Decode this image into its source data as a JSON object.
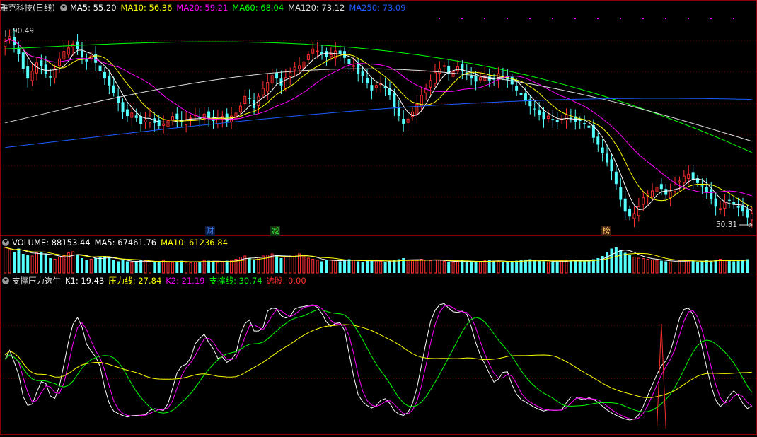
{
  "main_panel": {
    "stock_name": "雅克科技",
    "period": "(日线)",
    "indicators": [
      {
        "label": "MA5: 55.20",
        "color": "#ffffff"
      },
      {
        "label": "MA10: 56.36",
        "color": "#ffff00"
      },
      {
        "label": "MA20: 59.21",
        "color": "#ff00ff"
      },
      {
        "label": "MA60: 68.04",
        "color": "#00ff00"
      },
      {
        "label": "MA120: 73.12",
        "color": "#dddddd"
      },
      {
        "label": "MA250: 73.09",
        "color": "#1e5cff"
      }
    ],
    "high_label": "90.49",
    "low_label": "50.31",
    "markers": [
      {
        "text": "财",
        "color": "#3a8bff",
        "bg": "#101a40"
      },
      {
        "text": "减",
        "color": "#40ff40",
        "bg": "#103010"
      },
      {
        "text": "榜",
        "color": "#ffcc66",
        "bg": "#402010"
      }
    ]
  },
  "volume_panel": {
    "indicators": [
      {
        "label": "VOLUME: 88153.44",
        "color": "#ffffff"
      },
      {
        "label": "MA5: 67461.76",
        "color": "#ffffff"
      },
      {
        "label": "MA10: 61236.84",
        "color": "#ffff00"
      }
    ]
  },
  "osc_panel": {
    "title": "支撑压力选牛",
    "indicators": [
      {
        "label": "K1: 19.43",
        "color": "#ffffff"
      },
      {
        "label": "压力线: 27.84",
        "color": "#ffff00"
      },
      {
        "label": "K2: 21.19",
        "color": "#ff00ff"
      },
      {
        "label": "支撑线: 30.74",
        "color": "#00ff00"
      },
      {
        "label": "选股: 0.00",
        "color": "#ff3030"
      }
    ]
  },
  "colors": {
    "up": "#ff3030",
    "down": "#54ffff",
    "grid": "#8b0000",
    "ma5": "#ffffff",
    "ma10": "#ffff00",
    "ma20": "#ff00ff",
    "ma60": "#00ff00",
    "ma120": "#dddddd",
    "ma250": "#1e5cff"
  },
  "chart_data": {
    "type": "candlestick",
    "ylim": [
      50.31,
      90.49
    ],
    "close": [
      87.5,
      88.5,
      86.8,
      85.0,
      82.0,
      80.0,
      81.5,
      83.2,
      82.6,
      81.0,
      80.2,
      82.0,
      84.0,
      85.5,
      86.2,
      87.0,
      86.0,
      84.3,
      83.5,
      84.6,
      83.2,
      81.5,
      80.0,
      78.6,
      77.0,
      75.1,
      73.2,
      72.4,
      73.0,
      72.0,
      70.8,
      71.6,
      72.2,
      71.0,
      70.4,
      70.8,
      71.5,
      72.3,
      71.8,
      71.2,
      71.6,
      72.0,
      72.6,
      72.0,
      72.8,
      71.8,
      71.4,
      71.9,
      72.3,
      71.3,
      72.4,
      73.0,
      74.4,
      76.4,
      76.0,
      74.0,
      76.4,
      78.0,
      79.2,
      80.6,
      80.0,
      78.6,
      80.2,
      81.2,
      82.3,
      82.6,
      83.4,
      84.8,
      86.0,
      85.6,
      85.0,
      84.4,
      84.8,
      85.6,
      85.0,
      84.2,
      83.0,
      82.6,
      81.0,
      80.6,
      79.0,
      77.6,
      78.6,
      79.0,
      78.0,
      76.6,
      74.2,
      72.4,
      70.8,
      71.8,
      73.2,
      74.8,
      76.6,
      78.0,
      79.6,
      81.2,
      82.0,
      82.6,
      81.0,
      81.4,
      82.4,
      81.6,
      81.0,
      80.0,
      79.4,
      80.2,
      80.6,
      79.6,
      79.8,
      81.0,
      80.4,
      79.8,
      78.8,
      77.6,
      76.6,
      75.4,
      74.4,
      73.8,
      72.6,
      71.8,
      72.4,
      71.6,
      71.2,
      71.8,
      72.6,
      72.0,
      71.2,
      71.4,
      70.8,
      70.0,
      68.0,
      66.6,
      64.8,
      63.0,
      61.2,
      58.6,
      55.4,
      53.0,
      52.0,
      52.6,
      54.0,
      55.8,
      56.6,
      57.2,
      58.0,
      57.6,
      56.4,
      57.0,
      58.4,
      59.2,
      60.2,
      60.6,
      59.4,
      58.8,
      58.2,
      57.0,
      55.6,
      54.0,
      53.6,
      54.8,
      55.2,
      54.6,
      53.8,
      53.0,
      51.8,
      52.6
    ],
    "volume": [
      120,
      110,
      100,
      115,
      90,
      85,
      80,
      95,
      100,
      90,
      70,
      65,
      75,
      80,
      95,
      100,
      85,
      70,
      60,
      65,
      70,
      75,
      80,
      70,
      60,
      55,
      60,
      55,
      50,
      55,
      60,
      58,
      52,
      50,
      55,
      60,
      52,
      50,
      55,
      58,
      50,
      48,
      52,
      55,
      60,
      58,
      55,
      50,
      52,
      58,
      60,
      65,
      75,
      80,
      70,
      65,
      75,
      80,
      85,
      90,
      80,
      70,
      75,
      80,
      85,
      90,
      80,
      70,
      65,
      60,
      55,
      60,
      62,
      58,
      55,
      60,
      65,
      60,
      55,
      52,
      58,
      62,
      60,
      55,
      50,
      55,
      60,
      65,
      70,
      60,
      58,
      62,
      65,
      60,
      58,
      62,
      60,
      55,
      52,
      50,
      55,
      60,
      58,
      52,
      50,
      55,
      58,
      60,
      58,
      55,
      52,
      50,
      55,
      58,
      60,
      62,
      65,
      60,
      58,
      55,
      52,
      50,
      55,
      58,
      60,
      62,
      60,
      58,
      55,
      60,
      65,
      70,
      80,
      100,
      115,
      120,
      110,
      95,
      85,
      75,
      70,
      68,
      65,
      62,
      60,
      58,
      55,
      52,
      55,
      58,
      60,
      58,
      55,
      52,
      55,
      60,
      58,
      62,
      65,
      60,
      58,
      55,
      60,
      62,
      65
    ],
    "osc": {
      "names": [
        "K1",
        "压力线",
        "K2",
        "支撑线",
        "选股"
      ]
    }
  }
}
